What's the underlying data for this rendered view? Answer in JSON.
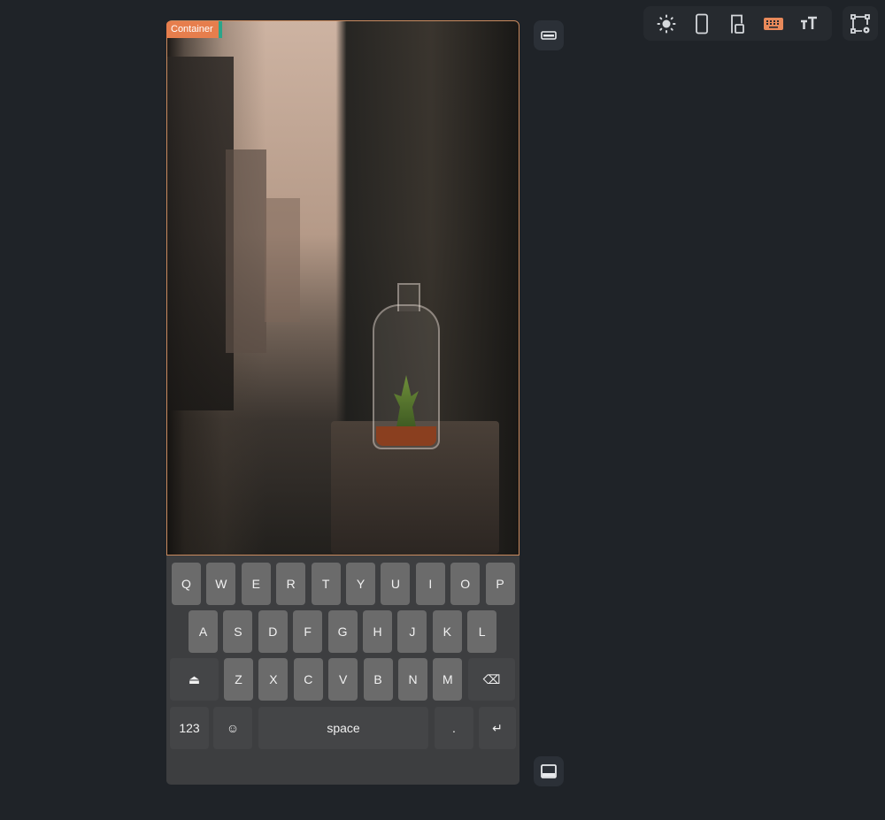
{
  "toolbar": {
    "items": [
      {
        "icon": "brightness-icon"
      },
      {
        "icon": "phone-icon"
      },
      {
        "icon": "tablet-icon"
      },
      {
        "icon": "keyboard-icon",
        "active": true
      },
      {
        "icon": "text-size-icon"
      }
    ],
    "settings_icon": "layout-settings-icon"
  },
  "colors": {
    "accent": "#e67e4d",
    "badge_stripe": "#2aa58a",
    "background": "#1f2328"
  },
  "container": {
    "badge_label": "Container"
  },
  "keyboard": {
    "row1": [
      "Q",
      "W",
      "E",
      "R",
      "T",
      "Y",
      "U",
      "I",
      "O",
      "P"
    ],
    "row2": [
      "A",
      "S",
      "D",
      "F",
      "G",
      "H",
      "J",
      "K",
      "L"
    ],
    "row3": [
      "Z",
      "X",
      "C",
      "V",
      "B",
      "N",
      "M"
    ],
    "shift_label": "⏏",
    "backspace_label": "⌫",
    "numbers_label": "123",
    "emoji_label": "☺",
    "space_label": "space",
    "period_label": ".",
    "enter_label": "↵"
  }
}
